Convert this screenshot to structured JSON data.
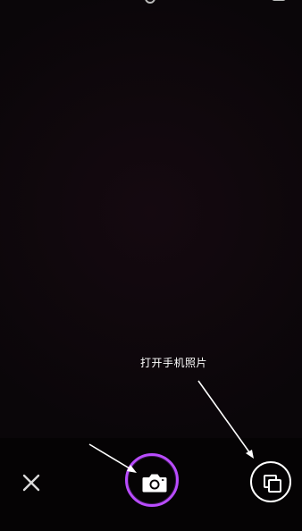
{
  "app": {
    "screen": "camera-capture"
  },
  "annotation": {
    "text": "打开手机照片"
  },
  "controls": {
    "close_icon": "close-icon",
    "shutter_icon": "camera-icon",
    "gallery_icon": "gallery-icon",
    "top_left_icon": "settings-icon",
    "top_right_icon": "camera-switch-icon"
  },
  "colors": {
    "background": "#0a0609",
    "shutter_ring": "#b94cff",
    "icon": "#ffffff",
    "annotation_arrow": "#ffffff"
  }
}
